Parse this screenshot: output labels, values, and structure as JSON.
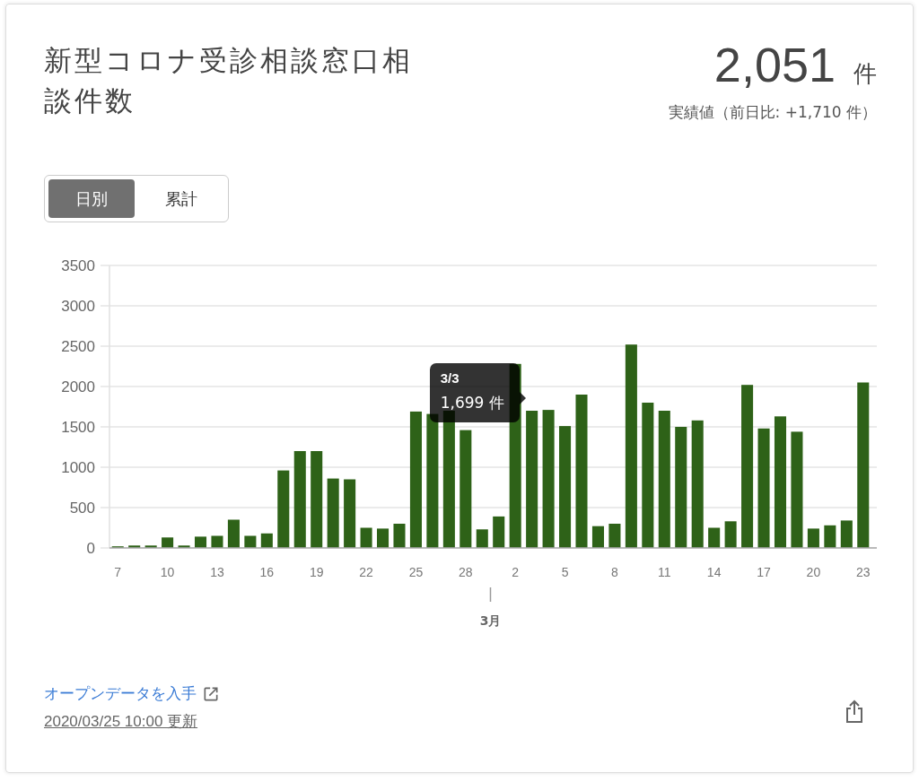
{
  "card": {
    "title": "新型コロナ受診相談窓口相談件数",
    "total": {
      "value": "2,051",
      "unit": "件",
      "note": "実績値（前日比: +1,710 件）"
    },
    "toggle": [
      {
        "label": "日別",
        "selected": true
      },
      {
        "label": "累計",
        "selected": false
      }
    ],
    "chart_data": {
      "type": "bar",
      "categories": [
        "7",
        null,
        null,
        "10",
        null,
        null,
        "13",
        null,
        null,
        "16",
        null,
        null,
        "19",
        null,
        null,
        "22",
        null,
        null,
        "25",
        null,
        null,
        "28",
        null,
        null,
        "2",
        null,
        null,
        "5",
        null,
        null,
        "8",
        null,
        null,
        "11",
        null,
        null,
        "14",
        null,
        null,
        "17",
        null,
        null,
        "20",
        null,
        null,
        "23"
      ],
      "series": [
        {
          "color": "#2e6218",
          "values": [
            20,
            30,
            30,
            130,
            30,
            140,
            150,
            350,
            150,
            180,
            960,
            1200,
            1200,
            860,
            850,
            250,
            240,
            300,
            1690,
            1660,
            1700,
            1460,
            230,
            390,
            2280,
            1700,
            1710,
            1510,
            1900,
            270,
            300,
            2520,
            1800,
            1700,
            1500,
            1580,
            250,
            330,
            2020,
            1480,
            1630,
            1440,
            240,
            280,
            340,
            2050
          ]
        }
      ],
      "ylim": [
        0,
        3500
      ],
      "yticks": [
        0,
        500,
        1000,
        1500,
        2000,
        2500,
        3000,
        3500
      ],
      "grid": true,
      "annotations": [
        "3月",
        "3/3",
        "1,699 件"
      ]
    },
    "open_data_link": "オープンデータを入手",
    "updated": "2020/03/25 10:00 更新"
  }
}
